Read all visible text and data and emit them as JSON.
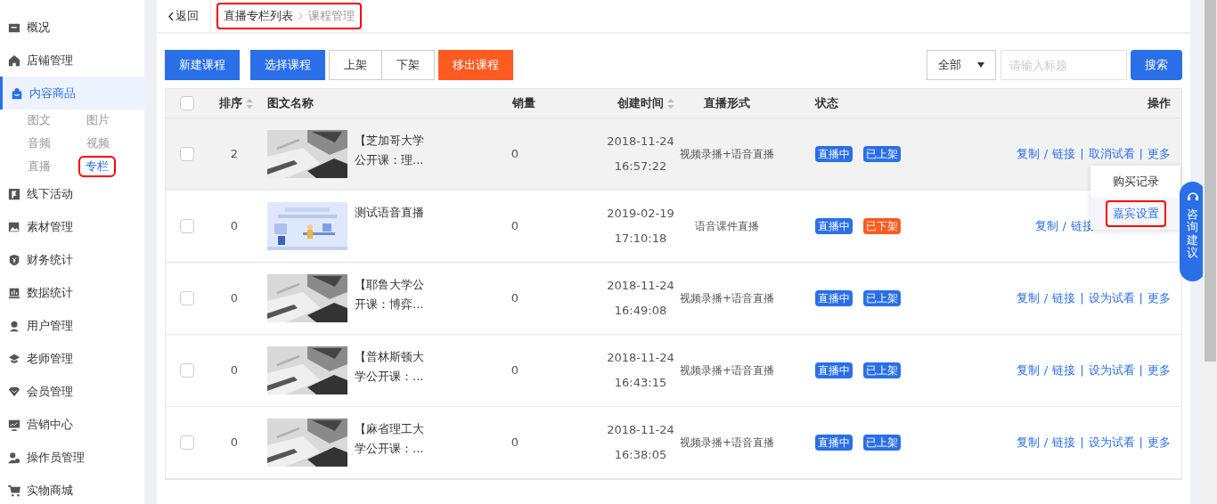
{
  "sidebar": {
    "items": [
      {
        "label": "概况",
        "selected": false
      },
      {
        "label": "店铺管理",
        "selected": false
      },
      {
        "label": "内容商品",
        "selected": true,
        "children": [
          {
            "label": "图文",
            "selected": false,
            "highlighted": false
          },
          {
            "label": "图片",
            "selected": false,
            "highlighted": false
          },
          {
            "label": "音频",
            "selected": false,
            "highlighted": false
          },
          {
            "label": "视频",
            "selected": false,
            "highlighted": false
          },
          {
            "label": "直播",
            "selected": false,
            "highlighted": false
          },
          {
            "label": "专栏",
            "selected": true,
            "highlighted": true
          }
        ]
      },
      {
        "label": "线下活动",
        "selected": false
      },
      {
        "label": "素材管理",
        "selected": false
      },
      {
        "label": "财务统计",
        "selected": false
      },
      {
        "label": "数据统计",
        "selected": false
      },
      {
        "label": "用户管理",
        "selected": false
      },
      {
        "label": "老师管理",
        "selected": false
      },
      {
        "label": "会员管理",
        "selected": false
      },
      {
        "label": "营销中心",
        "selected": false
      },
      {
        "label": "操作员管理",
        "selected": false
      },
      {
        "label": "实物商城",
        "selected": false
      }
    ]
  },
  "header": {
    "back": "返回",
    "breadcrumb": [
      "直播专栏列表",
      "课程管理"
    ],
    "breadcrumb_highlighted": true
  },
  "toolbar": {
    "buttons": [
      {
        "label": "新建课程",
        "kind": "primary"
      },
      {
        "label": "选择课程",
        "kind": "primary"
      },
      {
        "label": "上架",
        "kind": "plain"
      },
      {
        "label": "下架",
        "kind": "plain"
      },
      {
        "label": "移出课程",
        "kind": "danger"
      }
    ],
    "filter": "全部",
    "search_placeholder": "请输入标题",
    "search_button": "搜索"
  },
  "table": {
    "all_checked": false,
    "columns": [
      {
        "label": "排序",
        "sortable": true
      },
      {
        "label": "图文名称",
        "sortable": false
      },
      {
        "label": "销量",
        "sortable": false
      },
      {
        "label": "创建时间",
        "sortable": true
      },
      {
        "label": "直播形式",
        "sortable": false
      },
      {
        "label": "状态",
        "sortable": false
      },
      {
        "label": "操作",
        "sortable": false
      }
    ],
    "rows": [
      {
        "checked": false,
        "hovered": true,
        "sort": "2",
        "name": "【芝加哥大学公开课：理...",
        "sales": "0",
        "date": "2018-11-24",
        "time": "16:57:22",
        "format": "视频录播+语音直播",
        "live": "直播中",
        "shelf": "已上架",
        "shelf_on": true,
        "actions": [
          {
            "label": "复制"
          },
          {
            "sep": "/",
            "label": "链接"
          },
          {
            "sep": "|",
            "label": "取消试看"
          },
          {
            "sep": "|",
            "label": "更多"
          }
        ]
      },
      {
        "checked": false,
        "hovered": false,
        "sort": "0",
        "name": "测试语音直播",
        "sales": "0",
        "date": "2019-02-19",
        "time": "17:10:18",
        "format": "语音课件直播",
        "live": "直播中",
        "shelf": "已下架",
        "shelf_on": false,
        "actions": [
          {
            "label": "复制"
          },
          {
            "sep": "/",
            "label": "链接"
          }
        ]
      },
      {
        "checked": false,
        "hovered": false,
        "sort": "0",
        "name": "【耶鲁大学公开课：博弈...",
        "sales": "0",
        "date": "2018-11-24",
        "time": "16:49:08",
        "format": "视频录播+语音直播",
        "live": "直播中",
        "shelf": "已上架",
        "shelf_on": true,
        "actions": [
          {
            "label": "复制"
          },
          {
            "sep": "/",
            "label": "链接"
          },
          {
            "sep": "|",
            "label": "设为试看"
          },
          {
            "sep": "|",
            "label": "更多"
          }
        ]
      },
      {
        "checked": false,
        "hovered": false,
        "sort": "0",
        "name": "【普林斯顿大学公开课：...",
        "sales": "0",
        "date": "2018-11-24",
        "time": "16:43:15",
        "format": "视频录播+语音直播",
        "live": "直播中",
        "shelf": "已上架",
        "shelf_on": true,
        "actions": [
          {
            "label": "复制"
          },
          {
            "sep": "/",
            "label": "链接"
          },
          {
            "sep": "|",
            "label": "设为试看"
          },
          {
            "sep": "|",
            "label": "更多"
          }
        ]
      },
      {
        "checked": false,
        "hovered": false,
        "sort": "0",
        "name": "【麻省理工大学公开课：...",
        "sales": "0",
        "date": "2018-11-24",
        "time": "16:38:05",
        "format": "视频录播+语音直播",
        "live": "直播中",
        "shelf": "已上架",
        "shelf_on": true,
        "actions": [
          {
            "label": "复制"
          },
          {
            "sep": "/",
            "label": "链接"
          },
          {
            "sep": "|",
            "label": "设为试看"
          },
          {
            "sep": "|",
            "label": "更多"
          }
        ]
      }
    ]
  },
  "dropdown": {
    "items": [
      {
        "label": "购买记录",
        "highlighted": false
      },
      {
        "label": "嘉宾设置",
        "highlighted": true
      }
    ]
  },
  "float_button": "咨询建议"
}
